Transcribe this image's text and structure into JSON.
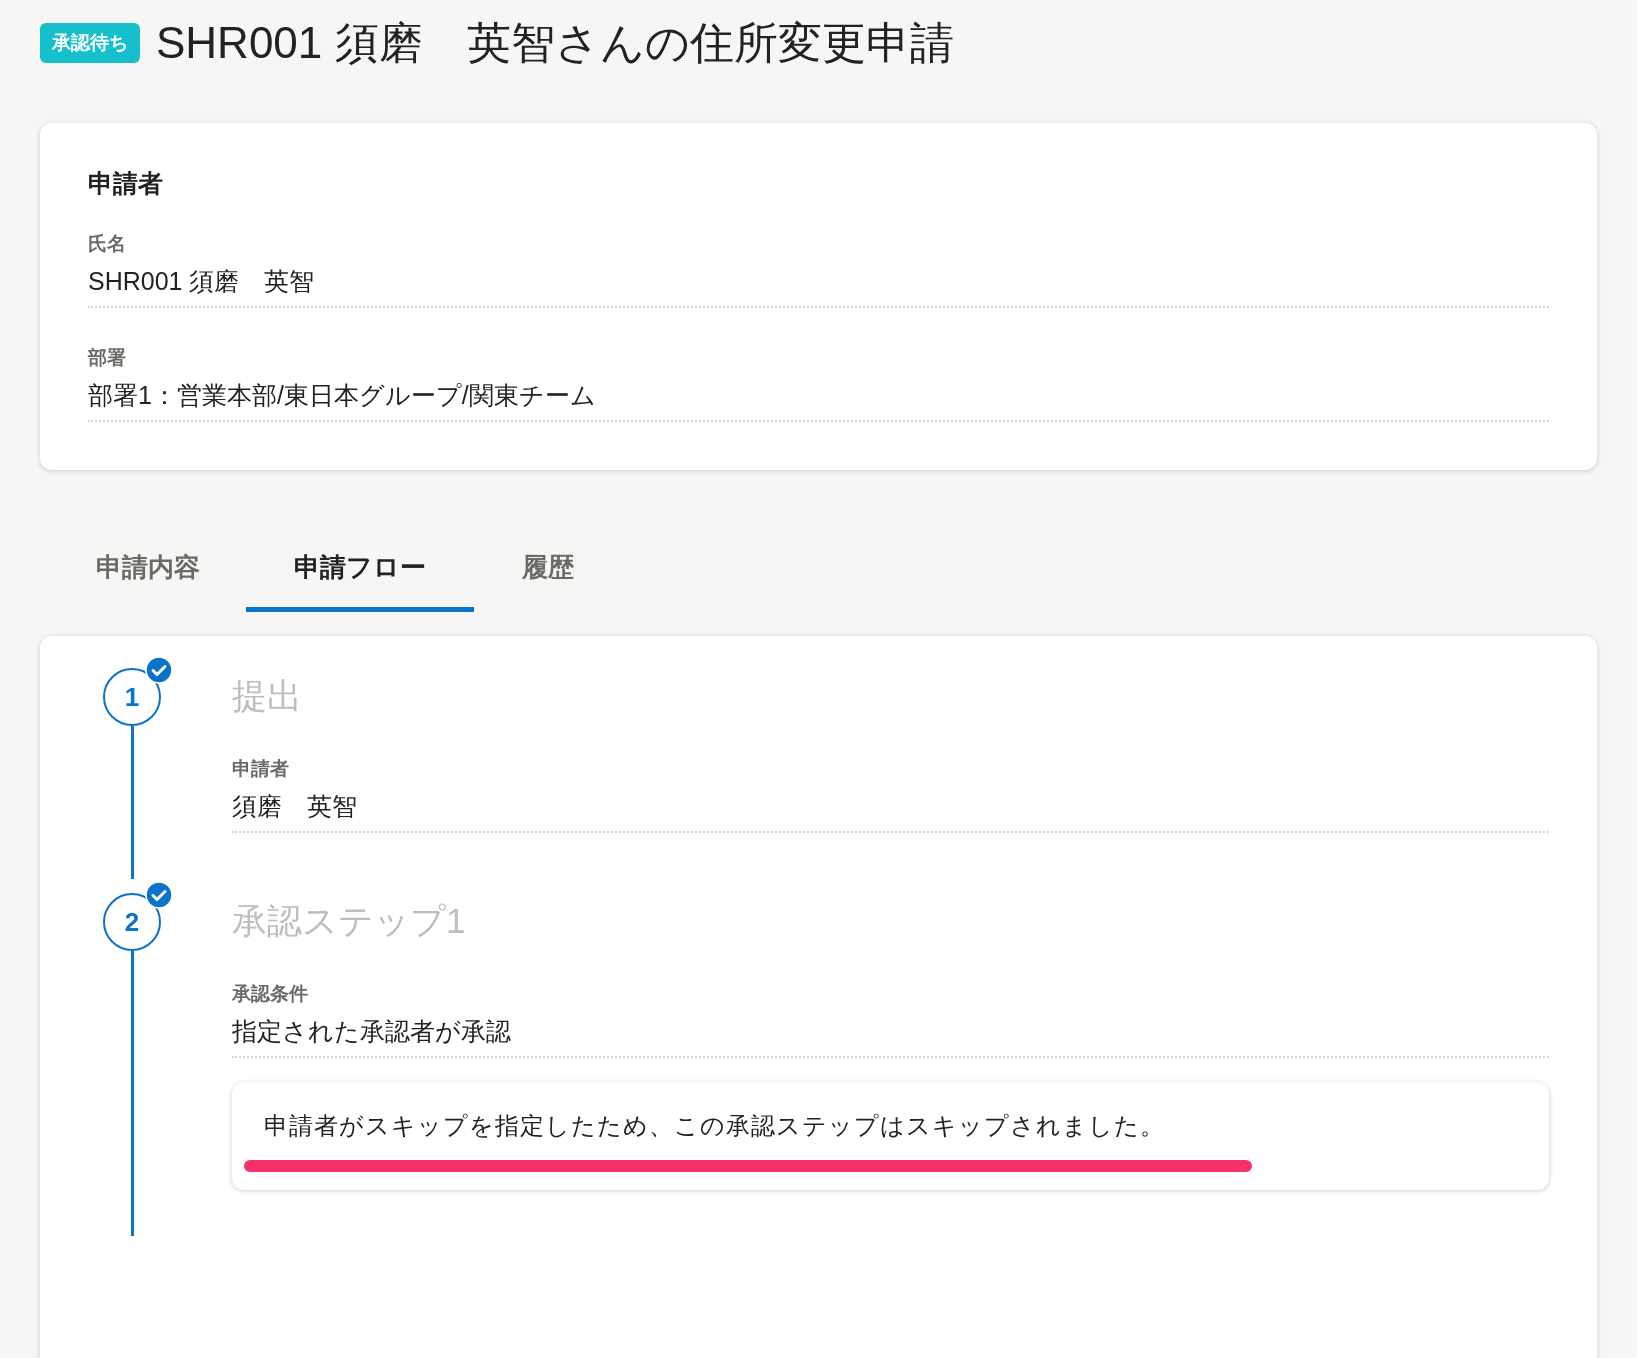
{
  "header": {
    "badge": "承認待ち",
    "title": "SHR001 須磨　英智さんの住所変更申請"
  },
  "applicant_card": {
    "heading": "申請者",
    "fields": [
      {
        "label": "氏名",
        "value": "SHR001 須磨　英智"
      },
      {
        "label": "部署",
        "value": "部署1：営業本部/東日本グループ/関東チーム"
      }
    ]
  },
  "tabs": [
    {
      "label": "申請内容",
      "selected": false
    },
    {
      "label": "申請フロー",
      "selected": true
    },
    {
      "label": "履歴",
      "selected": false
    }
  ],
  "flow": {
    "steps": [
      {
        "number": "1",
        "title": "提出",
        "completed": true,
        "fields": [
          {
            "label": "申請者",
            "value": "須磨　英智"
          }
        ]
      },
      {
        "number": "2",
        "title": "承認ステップ1",
        "completed": true,
        "fields": [
          {
            "label": "承認条件",
            "value": "指定された承認者が承認"
          }
        ],
        "notice": {
          "text": "申請者がスキップを指定したため、この承認ステップはスキップされました。",
          "highlighted": true
        }
      }
    ]
  }
}
